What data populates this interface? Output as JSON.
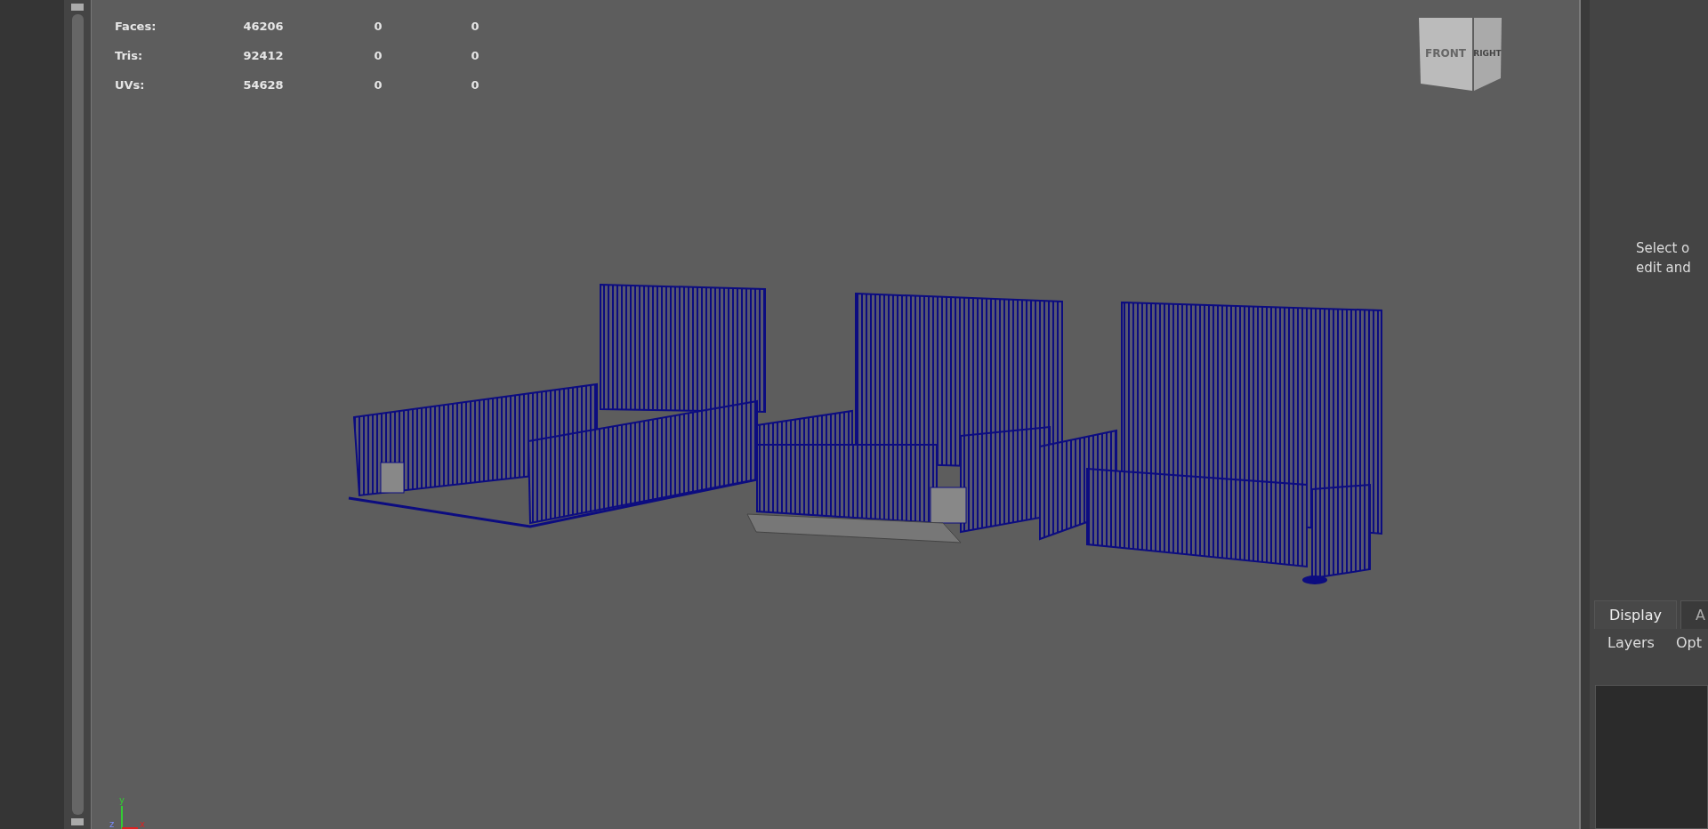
{
  "viewport": {
    "stats": [
      {
        "label": "Faces:",
        "values": [
          "46206",
          "0",
          "0"
        ]
      },
      {
        "label": "Tris:",
        "values": [
          "92412",
          "0",
          "0"
        ]
      },
      {
        "label": "UVs:",
        "values": [
          "54628",
          "0",
          "0"
        ]
      }
    ],
    "view_cube": {
      "faces": [
        "FRONT",
        "RIGHT"
      ]
    },
    "axis_gizmo": {
      "labels": [
        "y",
        "z",
        "x"
      ]
    }
  },
  "right_panel": {
    "message_lines": [
      "Select o",
      "edit and"
    ],
    "tabs": [
      {
        "label": "Display",
        "selected": true
      },
      {
        "label": "A",
        "selected": false
      }
    ],
    "menu": [
      "Layers",
      "Opt"
    ]
  }
}
